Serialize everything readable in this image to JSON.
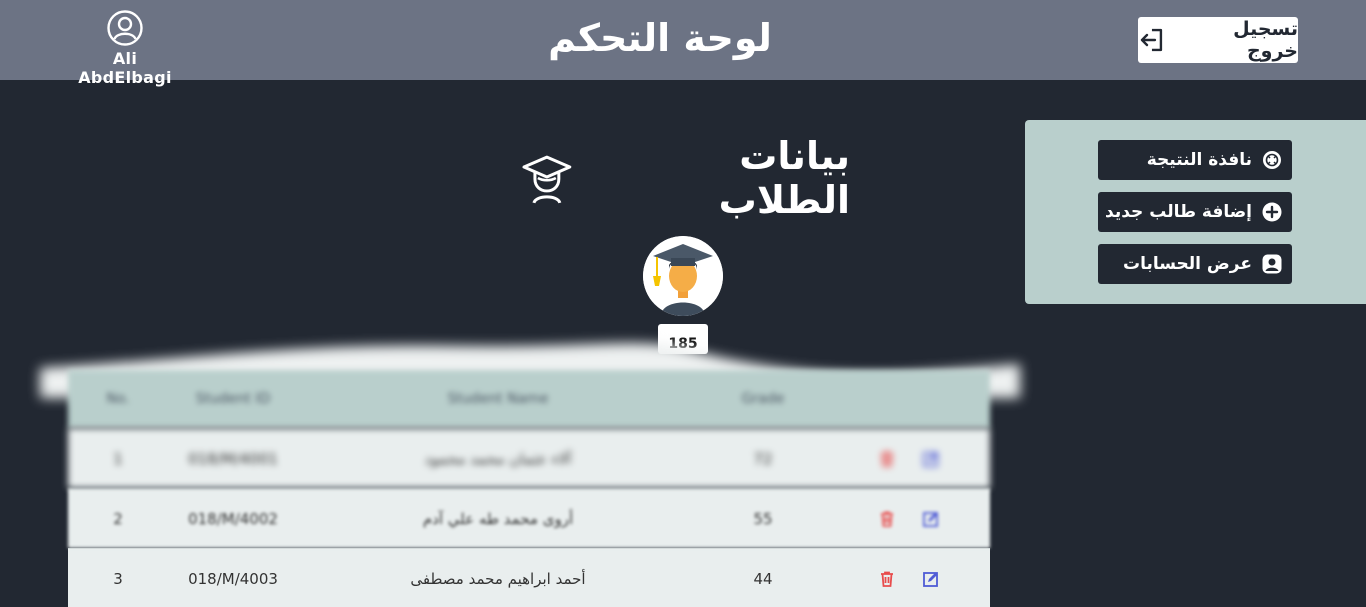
{
  "header": {
    "user_name": "Ali AbdElbagi",
    "app_title": "لوحة التحكم",
    "logout_label": "تسجيل خروج"
  },
  "sidebar": {
    "items": [
      {
        "label": "نافذة النتيجة",
        "icon": "result-icon"
      },
      {
        "label": "إضافة طالب جديد",
        "icon": "plus-circle-icon"
      },
      {
        "label": "عرض الحسابات",
        "icon": "account-icon"
      }
    ]
  },
  "main": {
    "section_title": "بيانات الطلاب",
    "student_count": "185"
  },
  "table": {
    "columns": [
      "No.",
      "Student ID",
      "Student Name",
      "Grade",
      ""
    ],
    "rows": [
      {
        "no": "1",
        "id": "018/M/4001",
        "name": "آلاء عثمان محمد محمود",
        "grade": "72"
      },
      {
        "no": "2",
        "id": "018/M/4002",
        "name": "أروى محمد طه علي آدم",
        "grade": "55"
      },
      {
        "no": "3",
        "id": "018/M/4003",
        "name": "أحمد ابراهيم محمد مصطفى",
        "grade": "44"
      }
    ]
  },
  "colors": {
    "topbar": "#6c7384",
    "background": "#222832",
    "panel": "#b9cfcc",
    "delete": "#e84c4c",
    "edit": "#4f5bd5"
  }
}
